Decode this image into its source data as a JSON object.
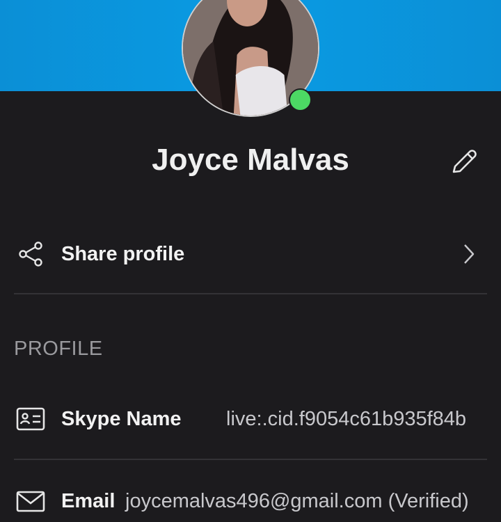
{
  "profile": {
    "name": "Joyce Malvas",
    "status_color": "#4cd964"
  },
  "actions": {
    "share_label": "Share profile"
  },
  "section": {
    "title": "PROFILE"
  },
  "fields": [
    {
      "label": "Skype Name",
      "value": "live:.cid.f9054c61b935f84b",
      "icon": "contact-card-icon"
    },
    {
      "label": "Email",
      "value": "joycemalvas496@gmail.com (Verified)",
      "icon": "mail-icon"
    }
  ],
  "colors": {
    "header": "#0a9be3",
    "background": "#1c1b1e"
  }
}
